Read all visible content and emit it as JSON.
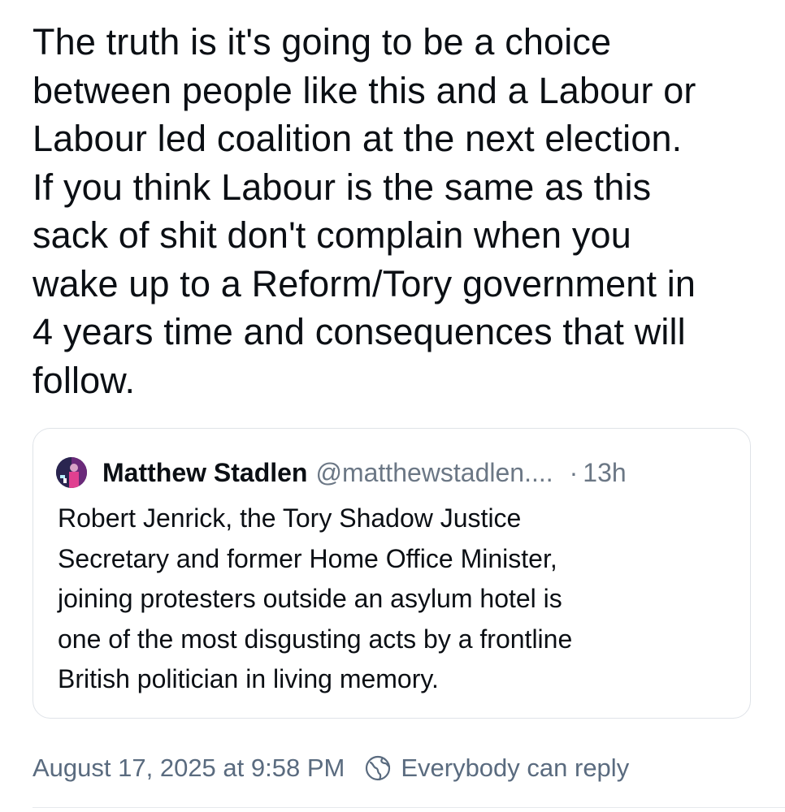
{
  "post": {
    "text": "The truth is it's going to be a choice\nbetween people like this and a Labour or\nLabour led coalition at the next election.\nIf you think Labour is the same as this\nsack of shit don't complain when you\nwake up to a Reform/Tory government in\n4 years time and consequences that will\nfollow."
  },
  "quote": {
    "author_name": "Matthew Stadlen",
    "author_handle": "@matthewstadlen....",
    "separator": "·",
    "time": "13h",
    "text": "Robert Jenrick, the Tory Shadow Justice\nSecretary and former Home Office Minister,\njoining protesters outside an asylum hotel is\none of the most disgusting acts by a frontline\nBritish politician in living memory."
  },
  "footer": {
    "timestamp": "August 17, 2025 at 9:58 PM",
    "reply_setting": "Everybody can reply",
    "reply_icon": "globe-icon"
  },
  "colors": {
    "text": "#0b0f14",
    "muted": "#6b7785",
    "footer": "#5a6b7f",
    "border": "#dfe3e8"
  }
}
